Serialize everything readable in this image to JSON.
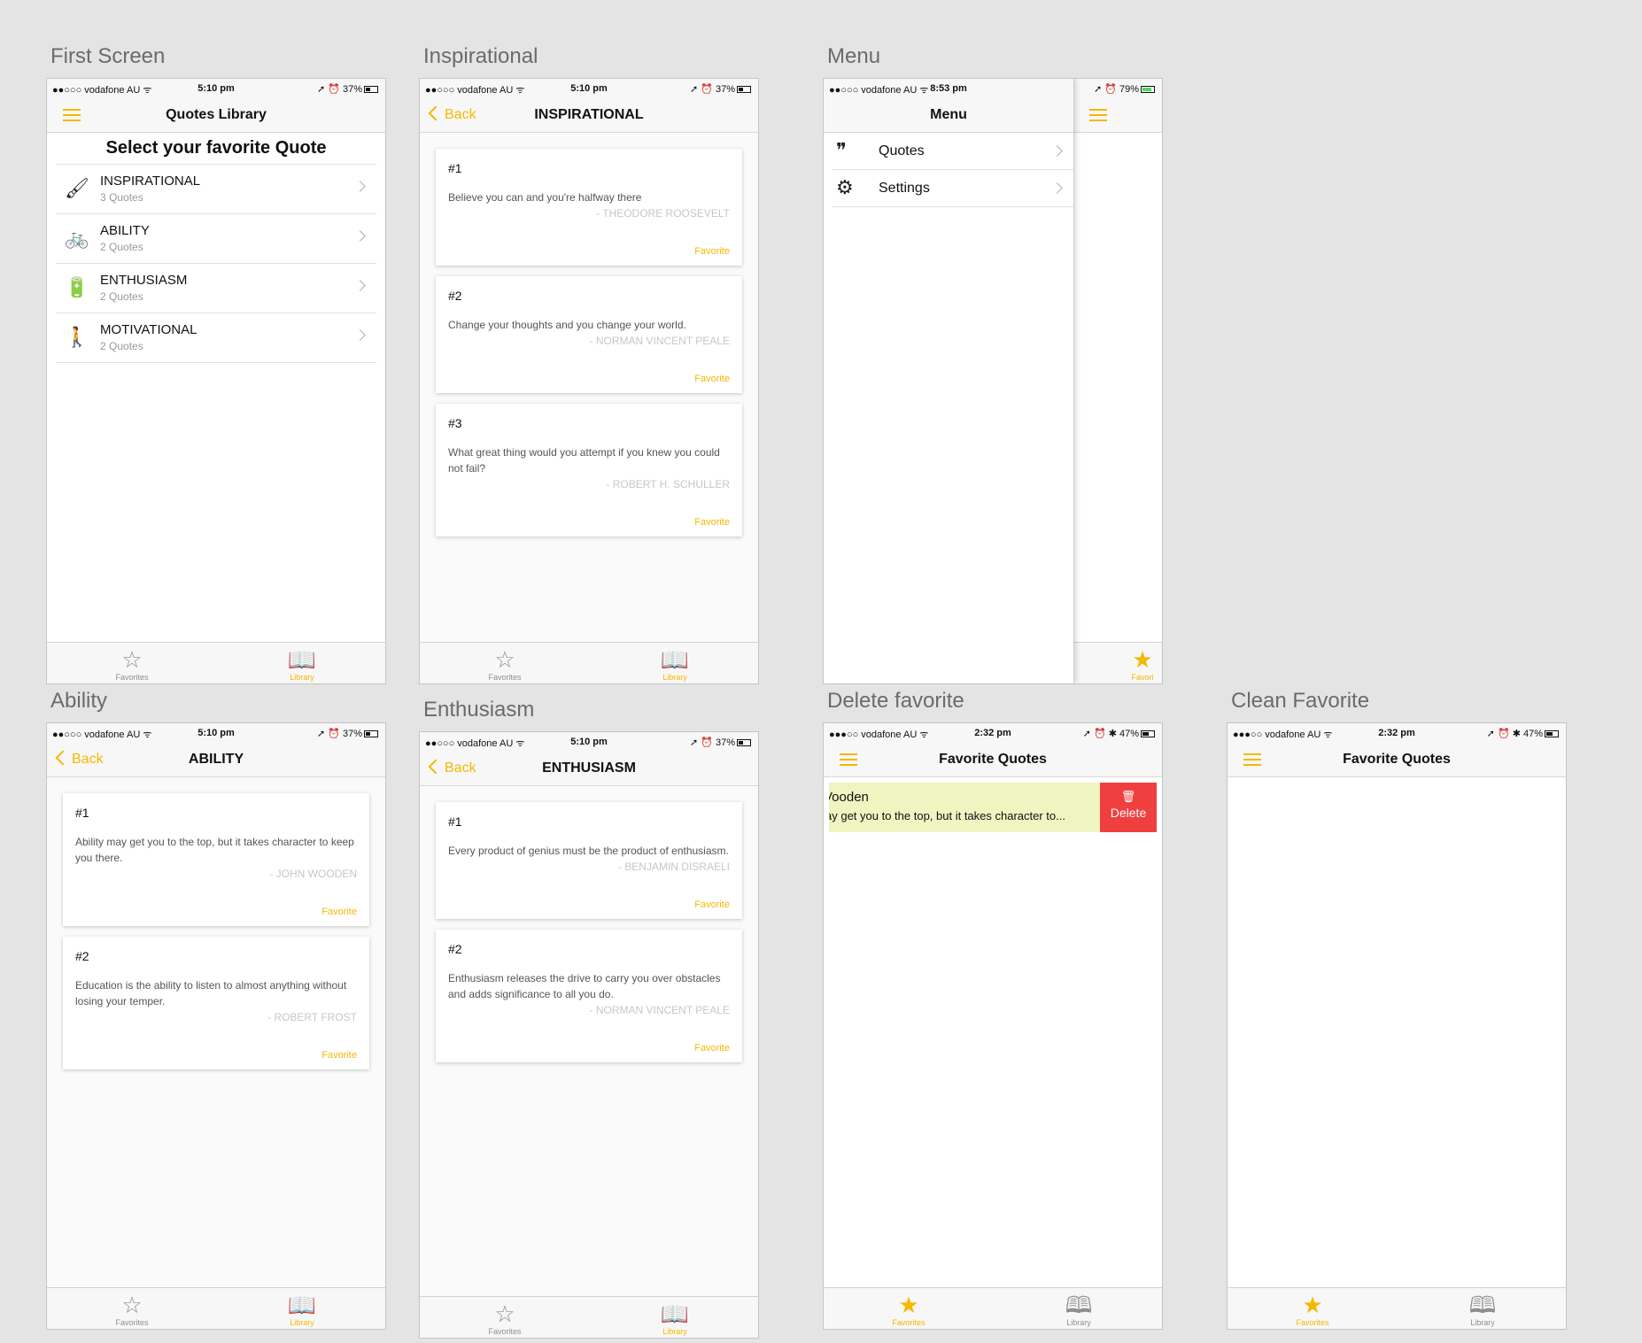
{
  "colors": {
    "accent": "#f5b800",
    "delete": "#f03f3f",
    "swipe_row": "#eff5c0"
  },
  "boards": {
    "first": {
      "label": "First Screen"
    },
    "inspirational": {
      "label": "Inspirational"
    },
    "menu": {
      "label": "Menu"
    },
    "ability": {
      "label": "Ability"
    },
    "enthusiasm": {
      "label": "Enthusiasm"
    },
    "delete": {
      "label": "Delete favorite"
    },
    "clean": {
      "label": "Clean Favorite"
    }
  },
  "status": {
    "carrier": "●●○○○ vodafone AU ᯤ",
    "carrier2": "●●●○○ vodafone AU ᯤ",
    "time_510": "5:10 pm",
    "time_853": "8:53 pm",
    "time_232": "2:32 pm",
    "right_37": "➚ ⏰ 37%",
    "right_79": "➚ ⏰ 79%",
    "right_47": "➚ ⏰ ✱ 47%"
  },
  "nav": {
    "back": "Back",
    "library_title": "Quotes Library",
    "inspirational_title": "INSPIRATIONAL",
    "ability_title": "ABILITY",
    "enthusiasm_title": "ENTHUSIASM",
    "menu_title": "Menu",
    "favorites_title": "Favorite Quotes"
  },
  "tabs": {
    "favorites": "Favorites",
    "library": "Library",
    "fav_partial": "Favori"
  },
  "first_screen": {
    "heading": "Select your favorite Quote",
    "categories": [
      {
        "title": "INSPIRATIONAL",
        "subtitle": "3 Quotes",
        "icon": "brush-icon"
      },
      {
        "title": "ABILITY",
        "subtitle": "2 Quotes",
        "icon": "bicycle-icon"
      },
      {
        "title": "ENTHUSIASM",
        "subtitle": "2 Quotes",
        "icon": "battery-icon"
      },
      {
        "title": "MOTIVATIONAL",
        "subtitle": "2 Quotes",
        "icon": "person-icon"
      }
    ]
  },
  "fav_label": "Favorite",
  "inspirational": [
    {
      "num": "#1",
      "quote": "Believe you can and you're halfway there",
      "author": "- THEODORE ROOSEVELT"
    },
    {
      "num": "#2",
      "quote": "Change your thoughts and you change your world.",
      "author": "- NORMAN VINCENT PEALE"
    },
    {
      "num": "#3",
      "quote": "What great thing would you attempt if you knew you could not fail?",
      "author": "- ROBERT H. SCHULLER"
    }
  ],
  "ability": [
    {
      "num": "#1",
      "quote": "Ability may get you to the top, but it takes character to keep you there.",
      "author": "- JOHN WOODEN"
    },
    {
      "num": "#2",
      "quote": "Education is the ability to listen to almost anything without losing your temper.",
      "author": "- ROBERT FROST"
    }
  ],
  "enthusiasm": [
    {
      "num": "#1",
      "quote": "Every product of genius must be the product of enthusiasm.",
      "author": "- BENJAMIN DISRAELI"
    },
    {
      "num": "#2",
      "quote": "Enthusiasm releases the drive to carry you over obstacles and adds significance to all you do.",
      "author": "- NORMAN VINCENT PEALE"
    }
  ],
  "menu": {
    "items": [
      {
        "label": "Quotes",
        "icon": "quote-icon"
      },
      {
        "label": "Settings",
        "icon": "gear-icon"
      }
    ]
  },
  "delete_row": {
    "title": "Vooden",
    "text": "ay get you to the top, but it takes character to...",
    "delete": "Delete"
  }
}
